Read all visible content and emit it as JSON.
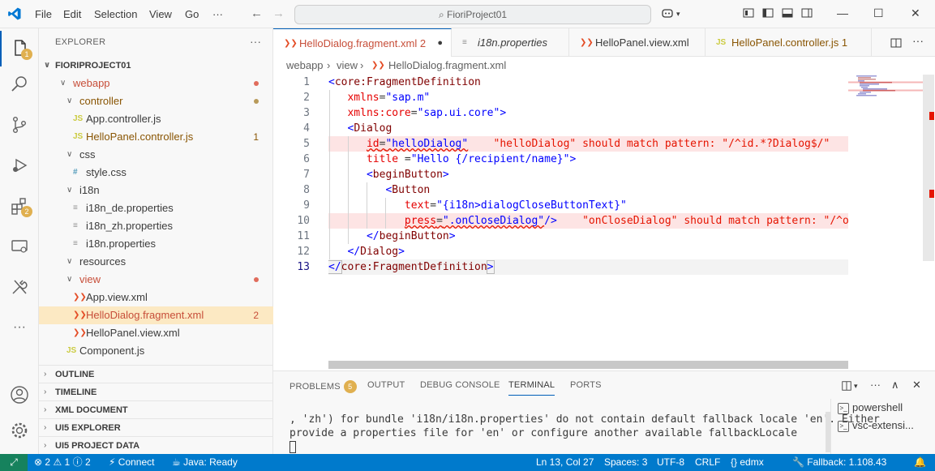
{
  "menu": {
    "file": "File",
    "edit": "Edit",
    "selection": "Selection",
    "view": "View",
    "go": "Go",
    "more": "···"
  },
  "titlebar": {
    "search_text": "FioriProject01"
  },
  "explorer": {
    "header": "EXPLORER",
    "project": "FIORIPROJECT01",
    "items": [
      {
        "label": "webapp",
        "type": "folder",
        "depth": 1,
        "deco": "dot",
        "color": "#e06c5c"
      },
      {
        "label": "controller",
        "type": "folder",
        "depth": 2,
        "deco": "dot",
        "color": "#b89a5a"
      },
      {
        "label": "App.controller.js",
        "type": "js",
        "depth": 3,
        "deco": ""
      },
      {
        "label": "HelloPanel.controller.js",
        "type": "js",
        "depth": 3,
        "deco": "1"
      },
      {
        "label": "css",
        "type": "folder",
        "depth": 2,
        "deco": ""
      },
      {
        "label": "style.css",
        "type": "css",
        "depth": 3,
        "deco": ""
      },
      {
        "label": "i18n",
        "type": "folder",
        "depth": 2,
        "deco": ""
      },
      {
        "label": "i18n_de.properties",
        "type": "prop",
        "depth": 3,
        "deco": ""
      },
      {
        "label": "i18n_zh.properties",
        "type": "prop",
        "depth": 3,
        "deco": ""
      },
      {
        "label": "i18n.properties",
        "type": "prop",
        "depth": 3,
        "deco": ""
      },
      {
        "label": "resources",
        "type": "folder",
        "depth": 2,
        "deco": ""
      },
      {
        "label": "view",
        "type": "folder",
        "depth": 2,
        "deco": "dot",
        "color": "#e06c5c"
      },
      {
        "label": "App.view.xml",
        "type": "xml",
        "depth": 3,
        "deco": ""
      },
      {
        "label": "HelloDialog.fragment.xml",
        "type": "xml",
        "depth": 3,
        "deco": "2",
        "selected": true
      },
      {
        "label": "HelloPanel.view.xml",
        "type": "xml",
        "depth": 3,
        "deco": ""
      },
      {
        "label": "Component.js",
        "type": "js",
        "depth": 2,
        "deco": ""
      }
    ],
    "panels": [
      "OUTLINE",
      "TIMELINE",
      "XML DOCUMENT",
      "UI5 EXPLORER",
      "UI5 PROJECT DATA"
    ]
  },
  "tabs": [
    {
      "label": "HelloDialog.fragment.xml",
      "count": "2",
      "dirty": "●",
      "type": "xml",
      "active": true
    },
    {
      "label": "i18n.properties",
      "type": "prop",
      "italic": true
    },
    {
      "label": "HelloPanel.view.xml",
      "type": "xml"
    },
    {
      "label": "HelloPanel.controller.js",
      "count": "1",
      "type": "js"
    }
  ],
  "icon_labels": {
    "js": "JS",
    "css": "#",
    "xml": "❯❯",
    "prop": "≡"
  },
  "breadcrumb": {
    "p1": "webapp",
    "p2": "view",
    "p3": "HelloDialog.fragment.xml"
  },
  "code": {
    "line_numbers": [
      "1",
      "2",
      "3",
      "4",
      "5",
      "6",
      "7",
      "8",
      "9",
      "10",
      "11",
      "12",
      "13"
    ],
    "l1_open": "<",
    "l1_tag": "core:FragmentDefinition",
    "l2_attr": "xmlns",
    "l2_eq": "=",
    "l2_val": "\"sap.m\"",
    "l3_attr": "xmlns:core",
    "l3_eq": "=",
    "l3_val": "\"sap.ui.core\"",
    "l3_close": ">",
    "l4_open": "<",
    "l4_tag": "Dialog",
    "l5_attr": "id",
    "l5_eq": "=",
    "l5_val": "\"helloDialog\"",
    "l5_msg": "\"helloDialog\" should match pattern: \"/^id.*?Dialog$/\"",
    "l6_attr": "title",
    "l6_eq": " =",
    "l6_val": "\"Hello {/recipient/name}\"",
    "l6_close": ">",
    "l7_open": "<",
    "l7_tag": "beginButton",
    "l7_close": ">",
    "l8_open": "<",
    "l8_tag": "Button",
    "l9_attr": "text",
    "l9_eq": "=",
    "l9_val": "\"{i18n>dialogCloseButtonText}\"",
    "l10_attr": "press",
    "l10_eq": "=",
    "l10_val": "\".onCloseDialog\"",
    "l10_close": "/>",
    "l10_msg": "\"onCloseDialog\" should match pattern: \"/^onB",
    "l11_open": "</",
    "l11_tag": "beginButton",
    "l11_close": ">",
    "l12_open": "</",
    "l12_tag": "Dialog",
    "l12_close": ">",
    "l13_open": "</",
    "l13_tag": "core:FragmentDefinition",
    "l13_close": ">"
  },
  "panel": {
    "tabs": {
      "problems": "PROBLEMS",
      "problems_count": "5",
      "output": "OUTPUT",
      "debug": "DEBUG CONSOLE",
      "terminal": "TERMINAL",
      "ports": "PORTS"
    },
    "terminal_text": ", 'zh') for bundle 'i18n/i18n.properties' do not contain default fallback locale 'en'. Either\nprovide a properties file for 'en' or configure another available fallbackLocale",
    "terminals": [
      "powershell",
      "vsc-extensi..."
    ]
  },
  "status": {
    "errors": "2",
    "warnings": "1",
    "info": "2",
    "connect": "Connect",
    "java": "Java: Ready",
    "position": "Ln 13, Col 27",
    "spaces": "Spaces: 3",
    "encoding": "UTF-8",
    "eol": "CRLF",
    "language": "edmx",
    "fallback": "Fallback: 1.108.43"
  },
  "colors": {
    "accent": "#005fb8",
    "statusbar": "#007acc",
    "remote": "#16825d",
    "error": "#e51400",
    "selection": "#fce9c3"
  }
}
